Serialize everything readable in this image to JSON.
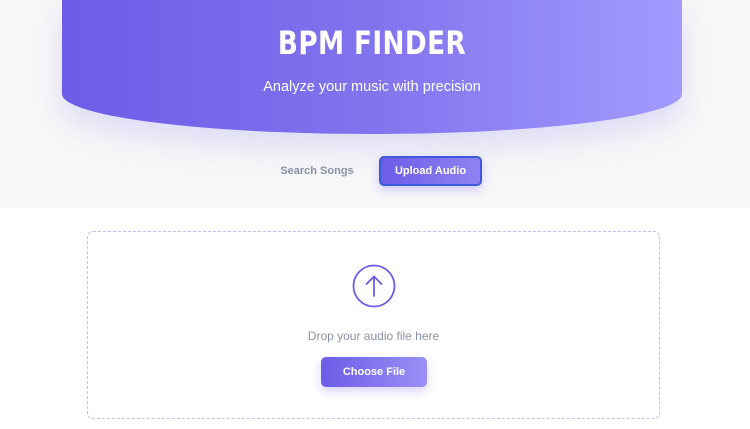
{
  "header": {
    "title": "BPM FINDER",
    "subtitle": "Analyze your music with precision"
  },
  "tabs": [
    {
      "label": "Search Songs",
      "active": false
    },
    {
      "label": "Upload Audio",
      "active": true
    }
  ],
  "upload": {
    "icon": "upload-arrow-icon",
    "prompt": "Drop your audio file here",
    "button_label": "Choose File"
  },
  "colors": {
    "accent": "#6c5ce7",
    "accent_light": "#a29bfe",
    "muted_text": "#8a93a6",
    "active_border": "#3d5bd9"
  }
}
